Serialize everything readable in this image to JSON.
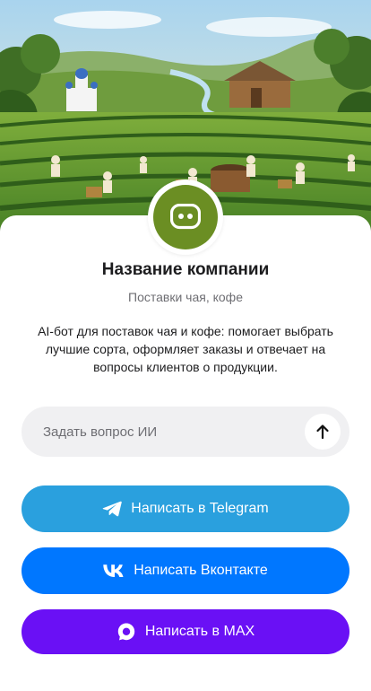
{
  "company": {
    "name": "Название компании",
    "subtitle": "Поставки чая, кофе",
    "description": "AI-бот для поставок чая и кофе: помогает выбрать лучшие сорта, оформляет заказы и отвечает на вопросы клиентов о продукции."
  },
  "ask": {
    "placeholder": "Задать вопрос ИИ",
    "value": ""
  },
  "buttons": {
    "telegram": {
      "label": "Написать в Telegram",
      "icon": "telegram-icon",
      "color": "#2aa0de"
    },
    "vk": {
      "label": "Написать Вконтакте",
      "icon": "vk-icon",
      "color": "#0077ff"
    },
    "max": {
      "label": "Написать в MAX",
      "icon": "max-icon",
      "color": "#6a10f5"
    }
  },
  "colors": {
    "avatar_bg": "#6b8e23"
  }
}
